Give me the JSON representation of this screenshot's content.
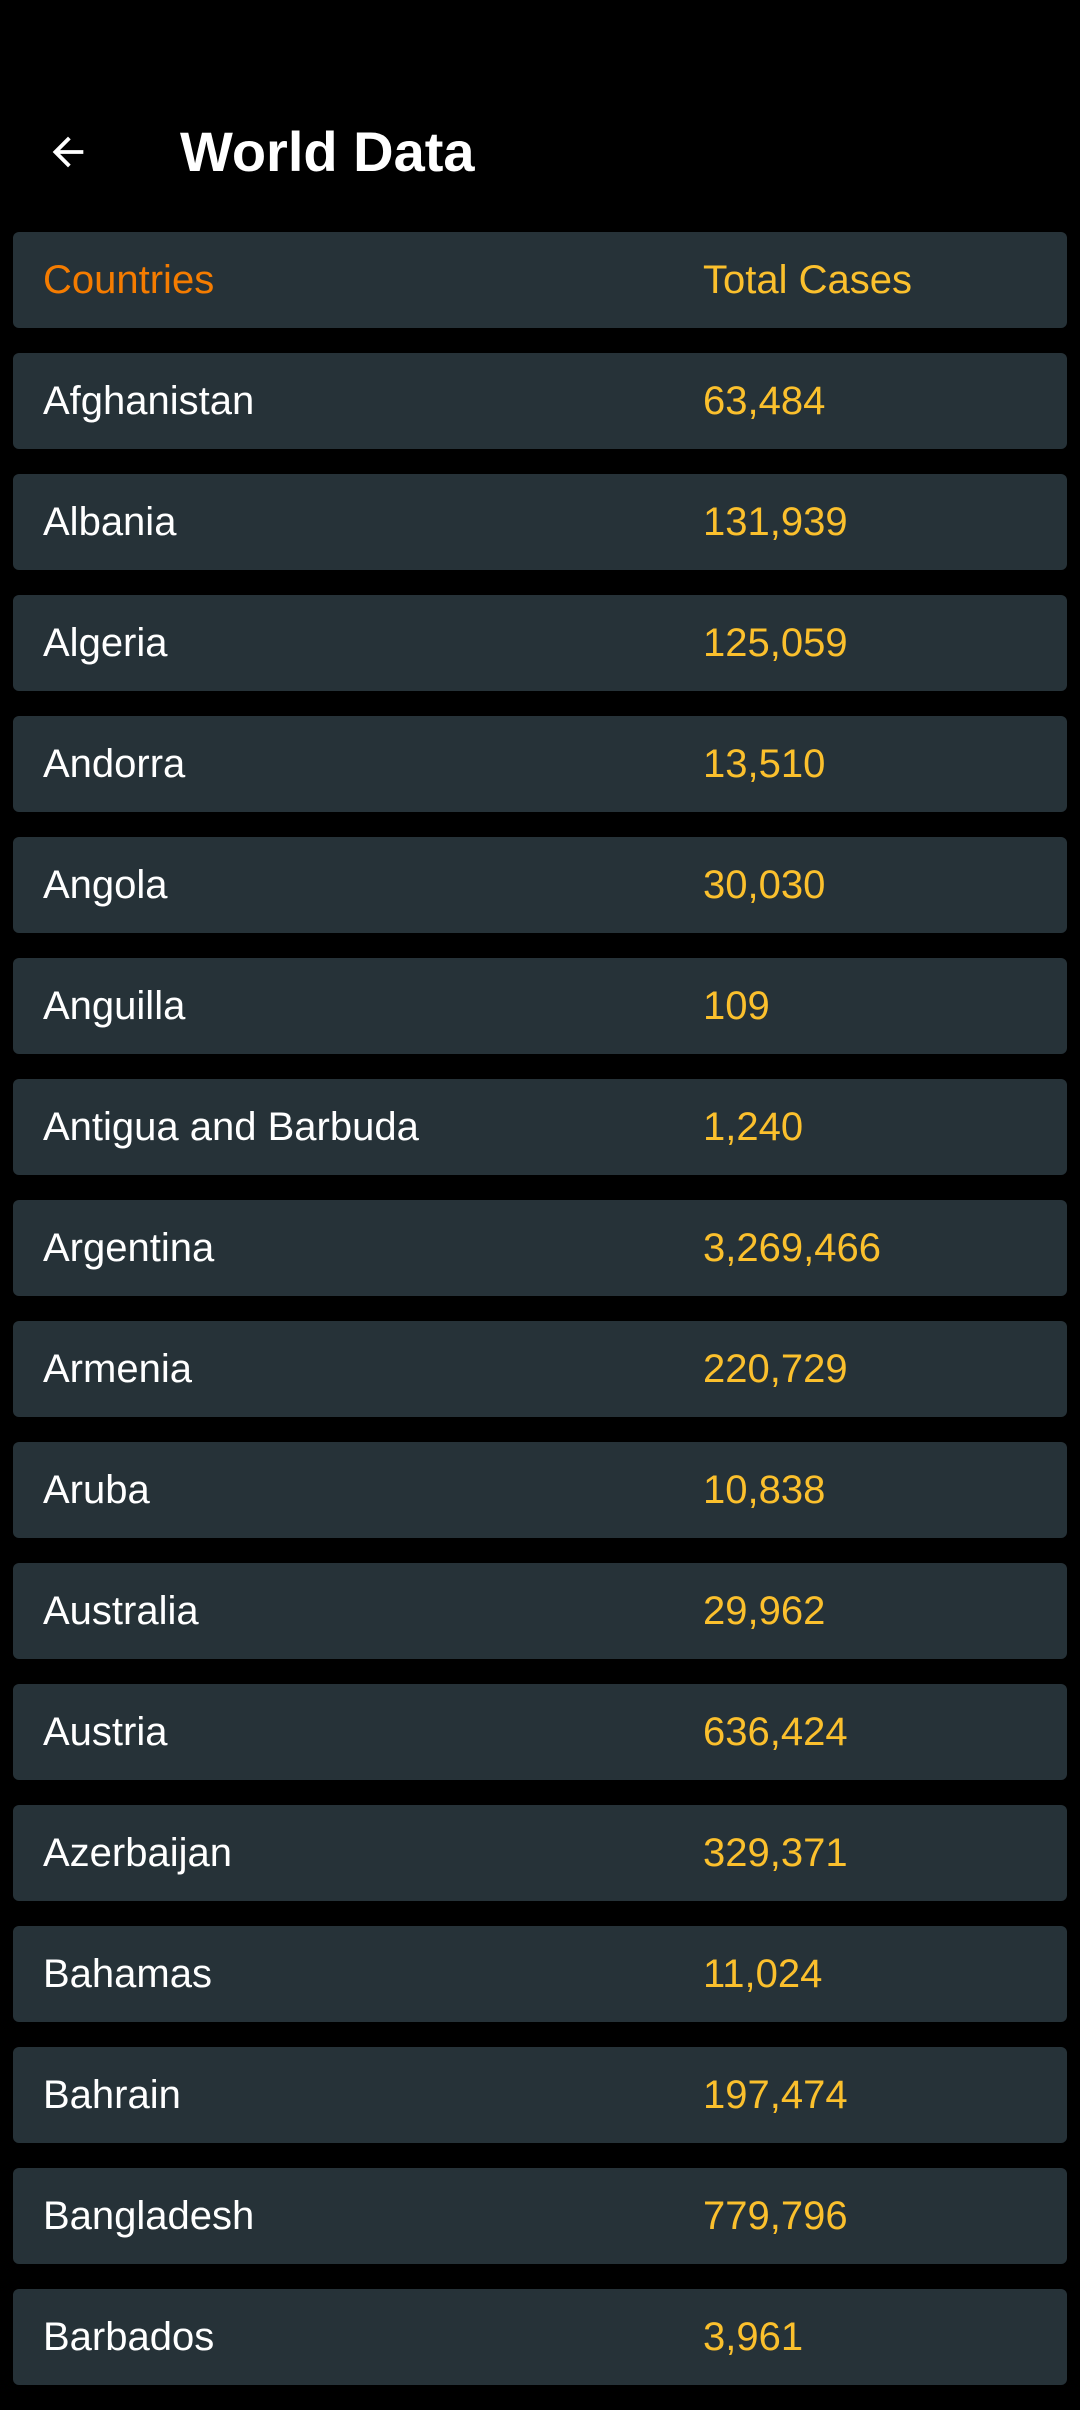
{
  "header": {
    "title": "World Data"
  },
  "table": {
    "columns": {
      "country": "Countries",
      "cases": "Total Cases"
    },
    "rows": [
      {
        "country": "Afghanistan",
        "cases": "63,484"
      },
      {
        "country": "Albania",
        "cases": "131,939"
      },
      {
        "country": "Algeria",
        "cases": "125,059"
      },
      {
        "country": "Andorra",
        "cases": "13,510"
      },
      {
        "country": "Angola",
        "cases": "30,030"
      },
      {
        "country": "Anguilla",
        "cases": "109"
      },
      {
        "country": "Antigua and Barbuda",
        "cases": "1,240"
      },
      {
        "country": "Argentina",
        "cases": "3,269,466"
      },
      {
        "country": "Armenia",
        "cases": "220,729"
      },
      {
        "country": "Aruba",
        "cases": "10,838"
      },
      {
        "country": "Australia",
        "cases": "29,962"
      },
      {
        "country": "Austria",
        "cases": "636,424"
      },
      {
        "country": "Azerbaijan",
        "cases": "329,371"
      },
      {
        "country": "Bahamas",
        "cases": "11,024"
      },
      {
        "country": "Bahrain",
        "cases": "197,474"
      },
      {
        "country": "Bangladesh",
        "cases": "779,796"
      },
      {
        "country": "Barbados",
        "cases": "3,961"
      }
    ]
  },
  "colors": {
    "background": "#000000",
    "row": "#263238",
    "header_label": "#f57c00",
    "value": "#fbc02d",
    "text": "#ffffff"
  },
  "icons": {
    "back": "arrow-left-icon"
  }
}
